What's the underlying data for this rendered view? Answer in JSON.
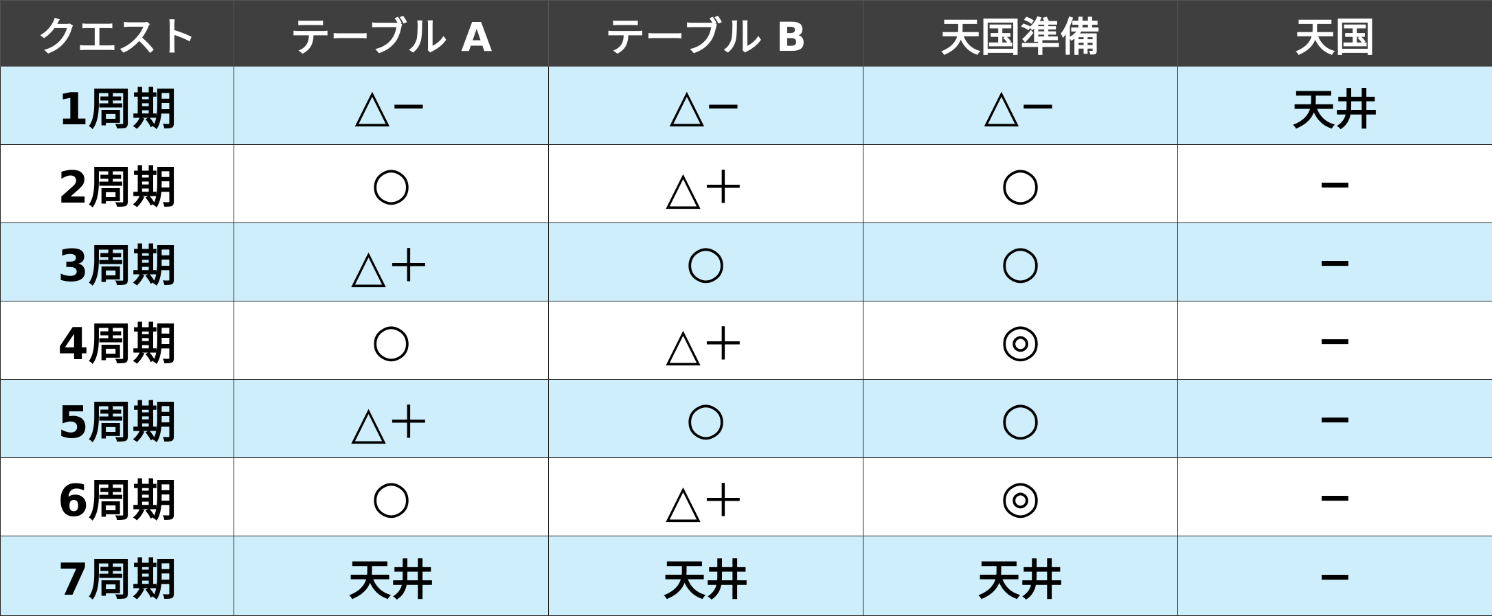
{
  "table": {
    "headers": [
      "クエスト",
      "テーブル A",
      "テーブル B",
      "天国準備",
      "天国"
    ],
    "rows": [
      [
        "1周期",
        "△−",
        "△−",
        "△−",
        "天井"
      ],
      [
        "2周期",
        "○",
        "△＋",
        "○",
        "−"
      ],
      [
        "3周期",
        "△＋",
        "○",
        "○",
        "−"
      ],
      [
        "4周期",
        "○",
        "△＋",
        "◎",
        "−"
      ],
      [
        "5周期",
        "△＋",
        "○",
        "○",
        "−"
      ],
      [
        "6周期",
        "○",
        "△＋",
        "◎",
        "−"
      ],
      [
        "7周期",
        "天井",
        "天井",
        "天井",
        "−"
      ]
    ]
  },
  "colors": {
    "header_bg": "#3f3f3f",
    "header_text": "#ffffff",
    "row_alt_bg": "#cdeefa",
    "row_bg": "#ffffff"
  }
}
